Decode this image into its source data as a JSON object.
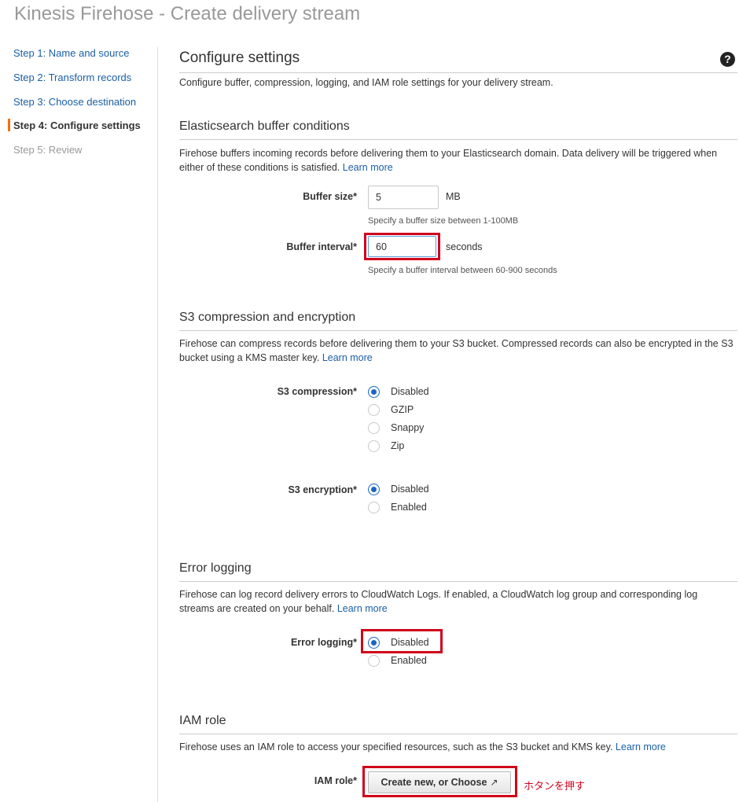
{
  "page": {
    "title": "Kinesis Firehose - Create delivery stream"
  },
  "sidebar": {
    "steps": [
      {
        "label": "Step 1: Name and source",
        "state": "link"
      },
      {
        "label": "Step 2: Transform records",
        "state": "link"
      },
      {
        "label": "Step 3: Choose destination",
        "state": "link"
      },
      {
        "label": "Step 4: Configure settings",
        "state": "active"
      },
      {
        "label": "Step 5: Review",
        "state": "disabled"
      }
    ]
  },
  "main": {
    "title": "Configure settings",
    "help_icon": "question-circle-icon",
    "description": "Configure buffer, compression, logging, and IAM role settings for your delivery stream."
  },
  "buffer": {
    "title": "Elasticsearch buffer conditions",
    "description": "Firehose buffers incoming records before delivering them to your Elasticsearch domain. Data delivery will be triggered when either of these conditions is satisfied.",
    "learn_more": "Learn more",
    "size": {
      "label": "Buffer size*",
      "value": "5",
      "unit": "MB",
      "hint": "Specify a buffer size between 1-100MB"
    },
    "interval": {
      "label": "Buffer interval*",
      "value": "60",
      "unit": "seconds",
      "hint": "Specify a buffer interval between 60-900 seconds"
    }
  },
  "s3": {
    "title": "S3 compression and encryption",
    "description": "Firehose can compress records before delivering them to your S3 bucket. Compressed records can also be encrypted in the S3 bucket using a KMS master key.",
    "learn_more": "Learn more",
    "compression": {
      "label": "S3 compression*",
      "options": [
        "Disabled",
        "GZIP",
        "Snappy",
        "Zip"
      ],
      "selected": "Disabled"
    },
    "encryption": {
      "label": "S3 encryption*",
      "options": [
        "Disabled",
        "Enabled"
      ],
      "selected": "Disabled"
    }
  },
  "error_logging": {
    "title": "Error logging",
    "description": "Firehose can log record delivery errors to CloudWatch Logs. If enabled, a CloudWatch log group and corresponding log streams are created on your behalf.",
    "learn_more": "Learn more",
    "label": "Error logging*",
    "options": [
      "Disabled",
      "Enabled"
    ],
    "selected": "Disabled"
  },
  "iam": {
    "title": "IAM role",
    "description": "Firehose uses an IAM role to access your specified resources, such as the S3 bucket and KMS key.",
    "learn_more": "Learn more",
    "label": "IAM role*",
    "button_label": "Create new, or Choose",
    "button_icon": "external-link-icon",
    "annotation": "ホタンを押す"
  },
  "colors": {
    "link": "#1a5fa6",
    "accent": "#ec7211",
    "highlight": "#d0021b",
    "radio_selected": "#1a66c5"
  }
}
